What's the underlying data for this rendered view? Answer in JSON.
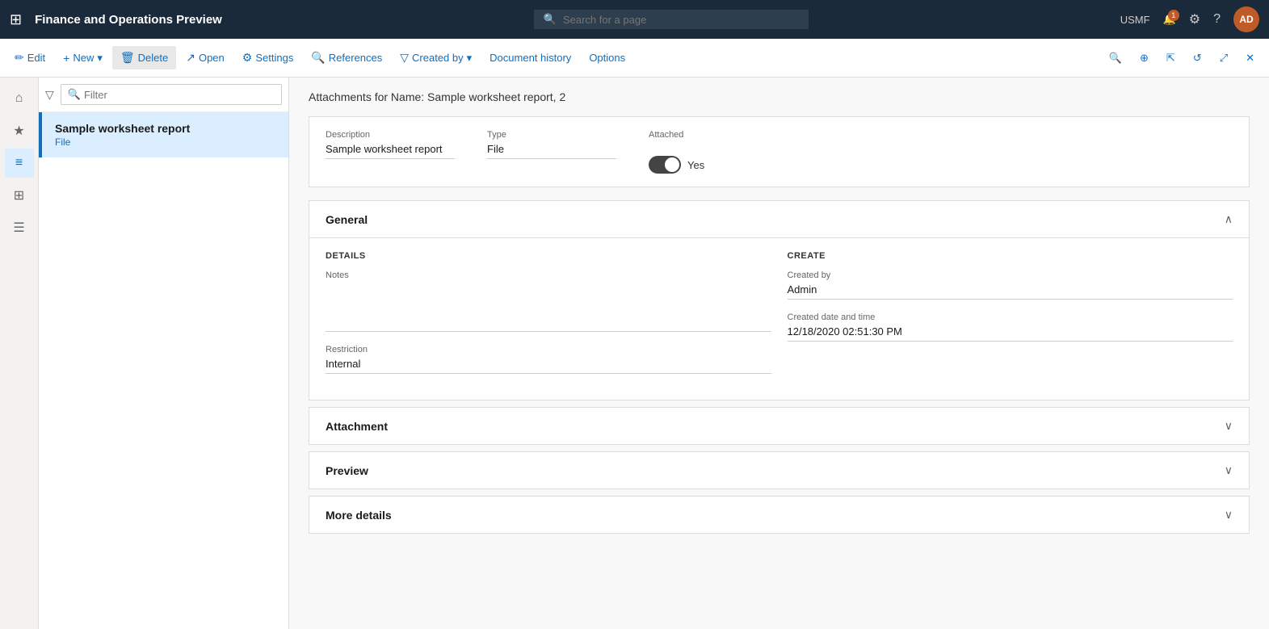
{
  "app": {
    "title": "Finance and Operations Preview",
    "search_placeholder": "Search for a page"
  },
  "topnav": {
    "user_code": "USMF",
    "notification_count": "1",
    "avatar_initials": "AD"
  },
  "toolbar": {
    "edit_label": "Edit",
    "new_label": "New",
    "delete_label": "Delete",
    "open_label": "Open",
    "settings_label": "Settings",
    "references_label": "References",
    "created_by_label": "Created by",
    "document_history_label": "Document history",
    "options_label": "Options"
  },
  "sidebar": {
    "icons": [
      "⊞",
      "★",
      "⊙",
      "⊟",
      "≡"
    ]
  },
  "list": {
    "filter_placeholder": "Filter",
    "items": [
      {
        "title": "Sample worksheet report",
        "subtitle": "File",
        "selected": true
      }
    ]
  },
  "detail": {
    "header": "Attachments for Name: Sample worksheet report, 2",
    "description_label": "Description",
    "description_value": "Sample worksheet report",
    "type_label": "Type",
    "type_value": "File",
    "attached_label": "Attached",
    "attached_toggle": true,
    "attached_text": "Yes",
    "sections": {
      "general": {
        "title": "General",
        "expanded": true,
        "details_heading": "DETAILS",
        "create_heading": "CREATE",
        "notes_label": "Notes",
        "notes_value": "",
        "restriction_label": "Restriction",
        "restriction_value": "Internal",
        "created_by_label": "Created by",
        "created_by_value": "Admin",
        "created_date_label": "Created date and time",
        "created_date_value": "12/18/2020 02:51:30 PM"
      },
      "attachment": {
        "title": "Attachment",
        "expanded": false
      },
      "preview": {
        "title": "Preview",
        "expanded": false
      },
      "more_details": {
        "title": "More details",
        "expanded": false
      }
    }
  }
}
